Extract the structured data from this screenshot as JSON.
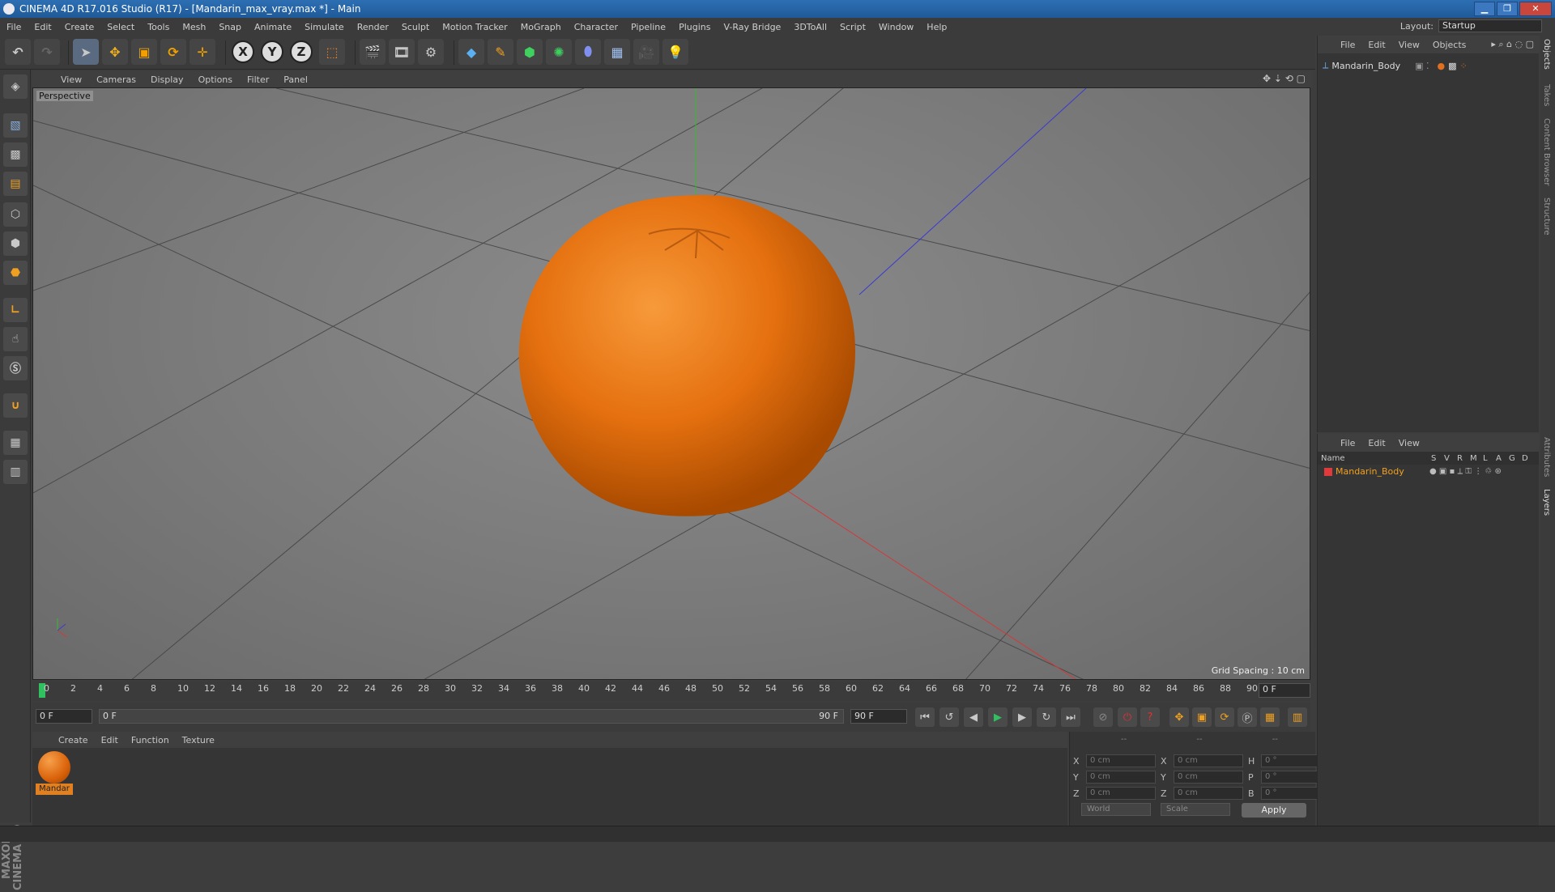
{
  "window": {
    "title": "CINEMA 4D R17.016 Studio (R17) - [Mandarin_max_vray.max *] - Main",
    "minimize": "▁",
    "restore": "❐",
    "close": "✕"
  },
  "menubar": {
    "items": [
      "File",
      "Edit",
      "Create",
      "Select",
      "Tools",
      "Mesh",
      "Snap",
      "Animate",
      "Simulate",
      "Render",
      "Sculpt",
      "Motion Tracker",
      "MoGraph",
      "Character",
      "Pipeline",
      "Plugins",
      "V-Ray Bridge",
      "3DToAll",
      "Script",
      "Window",
      "Help"
    ],
    "layout_label": "Layout:",
    "layout_value": "Startup"
  },
  "toolbar": {
    "axis_x": "X",
    "axis_y": "Y",
    "axis_z": "Z"
  },
  "viewport": {
    "menu": [
      "View",
      "Cameras",
      "Display",
      "Options",
      "Filter",
      "Panel"
    ],
    "label": "Perspective",
    "grid_spacing": "Grid Spacing : 10 cm",
    "axis_colors": {
      "x": "#d23a3a",
      "y": "#3ab83a",
      "z": "#3a3ad2"
    },
    "object_color": "#e8761a"
  },
  "timeline": {
    "ticks": [
      "0",
      "2",
      "4",
      "6",
      "8",
      "10",
      "12",
      "14",
      "16",
      "18",
      "20",
      "22",
      "24",
      "26",
      "28",
      "30",
      "32",
      "34",
      "36",
      "38",
      "40",
      "42",
      "44",
      "46",
      "48",
      "50",
      "52",
      "54",
      "56",
      "58",
      "60",
      "62",
      "64",
      "66",
      "68",
      "70",
      "72",
      "74",
      "76",
      "78",
      "80",
      "82",
      "84",
      "86",
      "88",
      "90"
    ],
    "current_frame": "0 F",
    "end_field": "0 F"
  },
  "playbar": {
    "start": "0 F",
    "range_start": "0 F",
    "range_end": "90 F",
    "end": "90 F"
  },
  "material_manager": {
    "menu": [
      "Create",
      "Edit",
      "Function",
      "Texture"
    ],
    "material_name": "Mandar"
  },
  "coordinates": {
    "headers": [
      "--",
      "--",
      "--"
    ],
    "rows": [
      {
        "pos_label": "X",
        "pos": "0 cm",
        "size_label": "X",
        "size": "0 cm",
        "rot_label": "H",
        "rot": "0 °"
      },
      {
        "pos_label": "Y",
        "pos": "0 cm",
        "size_label": "Y",
        "size": "0 cm",
        "rot_label": "P",
        "rot": "0 °"
      },
      {
        "pos_label": "Z",
        "pos": "0 cm",
        "size_label": "Z",
        "size": "0 cm",
        "rot_label": "B",
        "rot": "0 °"
      }
    ],
    "mode_select": "World",
    "scale_select": "Scale",
    "apply": "Apply"
  },
  "object_manager": {
    "menu": [
      "File",
      "Edit",
      "View",
      "Objects"
    ],
    "object_name": "Mandarin_Body"
  },
  "layer_manager": {
    "menu": [
      "File",
      "Edit",
      "View"
    ],
    "columns": [
      "Name",
      "S",
      "V",
      "R",
      "M",
      "L",
      "A",
      "G",
      "D"
    ],
    "layer_name": "Mandarin_Body",
    "layer_color": "#e03a3a"
  },
  "right_tabs": [
    "Objects",
    "Takes",
    "Content Browser",
    "Structure",
    "Attributes",
    "Layers"
  ],
  "branding": "MAXON CINEMA 4D"
}
